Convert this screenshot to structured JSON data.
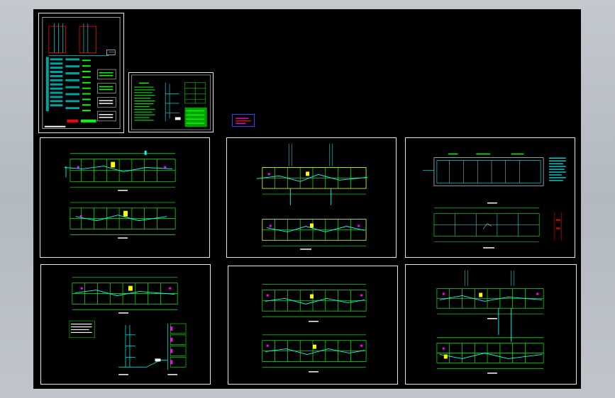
{
  "app": {
    "view": "CAD model space"
  },
  "colors": {
    "background_outer": "#bcc1c8",
    "model_space": "#000000",
    "frame": "#e6e6e6",
    "wall": "#00ff00",
    "pipe": "#00ffff",
    "text": "#ffffff",
    "fixture": "#ff00ff",
    "highlight": "#ffff00",
    "accent_red": "#ff0000",
    "legend_border": "#3040ff"
  },
  "sheets": [
    {
      "id": "system-diagram-sheet",
      "kind": "system-riser",
      "label": ""
    },
    {
      "id": "design-notes-sheet",
      "kind": "notes",
      "label": ""
    },
    {
      "id": "floor-plan-sheet-1",
      "kind": "plans",
      "label": ""
    },
    {
      "id": "floor-plan-sheet-2",
      "kind": "plans",
      "label": ""
    },
    {
      "id": "roof-plan-sheet",
      "kind": "roof",
      "label": ""
    },
    {
      "id": "floor-plan-riser-sheet",
      "kind": "plan-riser",
      "label": ""
    },
    {
      "id": "floor-plan-sheet-3",
      "kind": "plans",
      "label": ""
    },
    {
      "id": "floor-plan-sheet-4",
      "kind": "plans",
      "label": ""
    }
  ]
}
